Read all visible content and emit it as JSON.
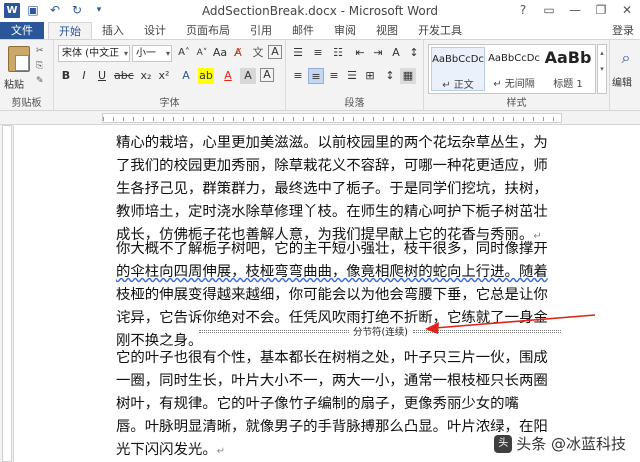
{
  "window": {
    "title": "AddSectionBreak.docx - Microsoft Word",
    "login": "登录"
  },
  "tabs": {
    "file": "文件",
    "items": [
      "开始",
      "插入",
      "设计",
      "页面布局",
      "引用",
      "邮件",
      "审阅",
      "视图",
      "开发工具"
    ]
  },
  "ribbon": {
    "clipboard": {
      "paste": "粘贴",
      "label": "剪贴板"
    },
    "font": {
      "label": "字体",
      "font_name": "宋体 (中文正",
      "font_size": "小一"
    },
    "paragraph": {
      "label": "段落"
    },
    "styles": {
      "label": "样式",
      "items": [
        {
          "sample": "AaBbCcDc",
          "name": "↵ 正文"
        },
        {
          "sample": "AaBbCcDc",
          "name": "↵ 无间隔"
        },
        {
          "sample": "AaBb",
          "name": "标题 1"
        }
      ]
    },
    "editing": {
      "label": "编辑"
    }
  },
  "document": {
    "para1": [
      "精心的栽培，心里更加美滋滋。以前校园里的两个花坛杂草丛生，为",
      "了我们的校园更加秀丽，除草栽花义不容辞，可哪一种花更适应，师",
      "生各抒己见，群策群力，最终选中了栀子。于是同学们挖坑，扶树，",
      "教师培土，定时浇水除草修理丫枝。在师生的精心呵护下栀子树茁壮",
      "成长，仿佛栀子花也善解人意，为我们提早献上它的花香与秀丽。"
    ],
    "para2": [
      "你大概不了解栀子树吧，它的主干短小强壮，枝干很多，同时像撑开",
      "的伞柱向四周伸展，枝桠弯弯曲曲，像竟相爬树的蛇向上行进。随着",
      "枝桠的伸展变得越来越细，你可能会以为他会弯腰下垂，它总是让你",
      "诧异，它告诉你绝对不会。任凭风吹雨打绝不折断，它练就了一身金",
      "刚不换之身。"
    ],
    "section_break_label": "分节符(连续)",
    "para3": [
      "它的叶子也很有个性，基本都长在树梢之处，叶子只三片一伙，围成",
      "一圈，同时生长，叶片大小不一，两大一小，通常一根枝桠只长两圈",
      "树叶，有规律。它的叶子像竹子编制的扇子，更像秀丽少女的嘴",
      "唇。叶脉明显清晰，就像男子的手背脉搏那么凸显。叶片浓绿，在阳",
      "光下闪闪发光。"
    ],
    "para_mark": "↵"
  },
  "watermark": "头条 @冰蓝科技",
  "colors": {
    "accent": "#2b579a",
    "annotation_arrow": "#e2231a"
  }
}
